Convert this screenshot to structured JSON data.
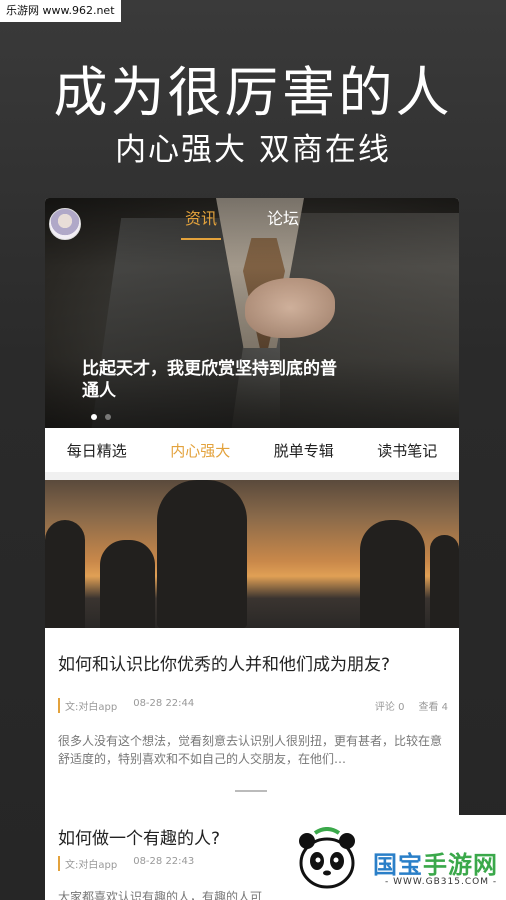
{
  "watermark_tl": "乐游网 www.962.net",
  "hero": {
    "title": "成为很厉害的人",
    "subtitle": "内心强大 双商在线"
  },
  "banner": {
    "tabs": [
      "资讯",
      "论坛"
    ],
    "active_tab": 0,
    "caption": "比起天才，我更欣赏坚持到底的普通人",
    "pages": 2,
    "current_page": 0
  },
  "categories": {
    "items": [
      "每日精选",
      "内心强大",
      "脱单专辑",
      "读书笔记"
    ],
    "active": 1
  },
  "articles": [
    {
      "title": "如何和认识比你优秀的人并和他们成为朋友?",
      "source": "文:对白app",
      "time": "08-28 22:44",
      "comments": "评论 0",
      "views": "查看 4",
      "excerpt": "很多人没有这个想法，觉看刻意去认识别人很别扭，更有甚者，比较在意舒适度的，特别喜欢和不如自己的人交朋友，在他们…"
    },
    {
      "title": "如何做一个有趣的人?",
      "source": "文:对白app",
      "time": "08-28 22:43",
      "excerpt": "大家都喜欢认识有趣的人，有趣的人可"
    }
  ],
  "watermark_br": {
    "name_a": "国宝",
    "name_b": "手游网",
    "url": "- WWW.GB315.COM -"
  },
  "colors": {
    "accent": "#e3a23c"
  }
}
